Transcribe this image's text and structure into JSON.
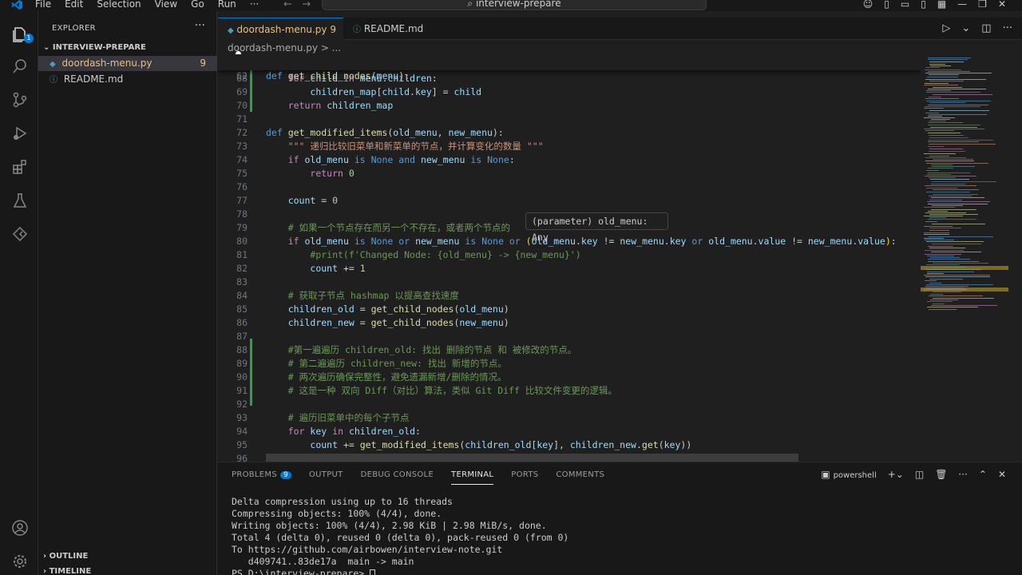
{
  "titlebar": {
    "menu": [
      "File",
      "Edit",
      "Selection",
      "View",
      "Go",
      "Run",
      "···"
    ],
    "search": "interview-prepare"
  },
  "activity": {
    "badge": "1"
  },
  "sidebar": {
    "title": "EXPLORER",
    "section": "INTERVIEW-PREPARE",
    "files": [
      {
        "name": "doordash-menu.py",
        "count": "9"
      },
      {
        "name": "README.md",
        "count": ""
      }
    ],
    "outline": "OUTLINE",
    "timeline": "TIMELINE"
  },
  "tabs": [
    {
      "label": "doordash-menu.py",
      "count": "9"
    },
    {
      "label": "README.md"
    }
  ],
  "breadcrumb": "doordash-menu.py > ...",
  "hover": "(parameter) old_menu: Any",
  "code": {
    "62": [
      "def",
      "get_child_nodes",
      "(menu):"
    ],
    "68": "for child in menu.children:",
    "69": "children_map[child.key] = child",
    "70": "return children_map",
    "72": "def get_modified_items(old_menu, new_menu):",
    "73": "\"\"\" 递归比较旧菜单和新菜单的节点，并计算变化的数量 \"\"\"",
    "74": "if old_menu is None and new_menu is None:",
    "75": "return 0",
    "77": "count = 0",
    "79": "# 如果一个节点存在而另一个不存在，或者两个节点的",
    "80": "if old_menu is None or new_menu is None or (old_menu.key != new_menu.key or old_menu.value != new_menu.value):",
    "81": "#print(f'Changed Node: {old_menu} -> {new_menu}')",
    "82": "count += 1",
    "84": "# 获取子节点 hashmap 以提高查找速度",
    "85": "children_old = get_child_nodes(old_menu)",
    "86": "children_new = get_child_nodes(new_menu)",
    "88": "#第一遍遍历 children_old: 找出 删除的节点 和 被修改的节点。",
    "89": "# 第二遍遍历 children_new: 找出 新增的节点。",
    "90": "# 两次遍历确保完整性，避免遗漏新增/删除的情况。",
    "91": "# 这是一种 双向 Diff（对比）算法，类似 Git Diff 比较文件变更的逻辑。",
    "93": "# 遍历旧菜单中的每个子节点",
    "94": "for key in children_old:",
    "95": "count += get_modified_items(children_old[key], children_new.get(key))"
  },
  "panel": {
    "tabs": [
      "PROBLEMS",
      "OUTPUT",
      "DEBUG CONSOLE",
      "TERMINAL",
      "PORTS",
      "COMMENTS"
    ],
    "problems_count": "9",
    "shell": "powershell",
    "terminal_lines": [
      "Delta compression using up to 16 threads",
      "Compressing objects: 100% (4/4), done.",
      "Writing objects: 100% (4/4), 2.98 KiB | 2.98 MiB/s, done.",
      "Total 4 (delta 0), reused 0 (delta 0), pack-reused 0 (from 0)",
      "To https://github.com/airbowen/interview-note.git",
      "   d409741..83de17a  main -> main",
      "PS D:\\interview-prepare> "
    ]
  }
}
